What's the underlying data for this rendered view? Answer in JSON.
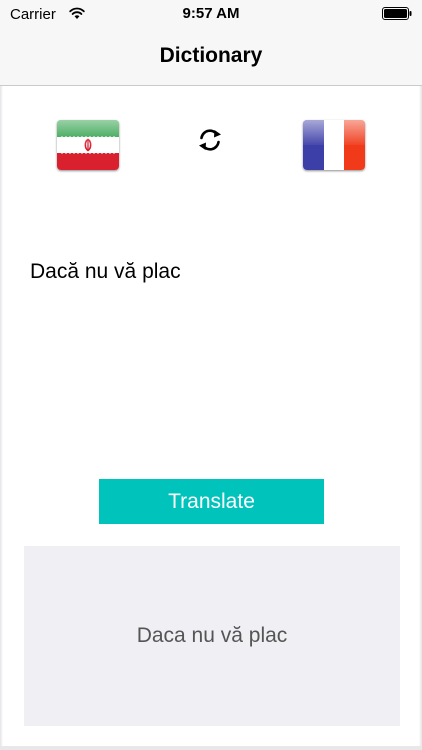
{
  "status_bar": {
    "carrier": "Carrier",
    "time": "9:57 AM"
  },
  "nav": {
    "title": "Dictionary"
  },
  "languages": {
    "source_icon": "iran-flag-icon",
    "target_icon": "france-flag-icon",
    "swap_icon": "swap-refresh-icon"
  },
  "input": {
    "text": "Dacă nu vă plac"
  },
  "actions": {
    "translate_label": "Translate"
  },
  "output": {
    "text": "Daca nu vă plac"
  },
  "colors": {
    "accent": "#00c4bc",
    "result_background": "#efeff4",
    "bar_background": "#f7f7f8"
  }
}
